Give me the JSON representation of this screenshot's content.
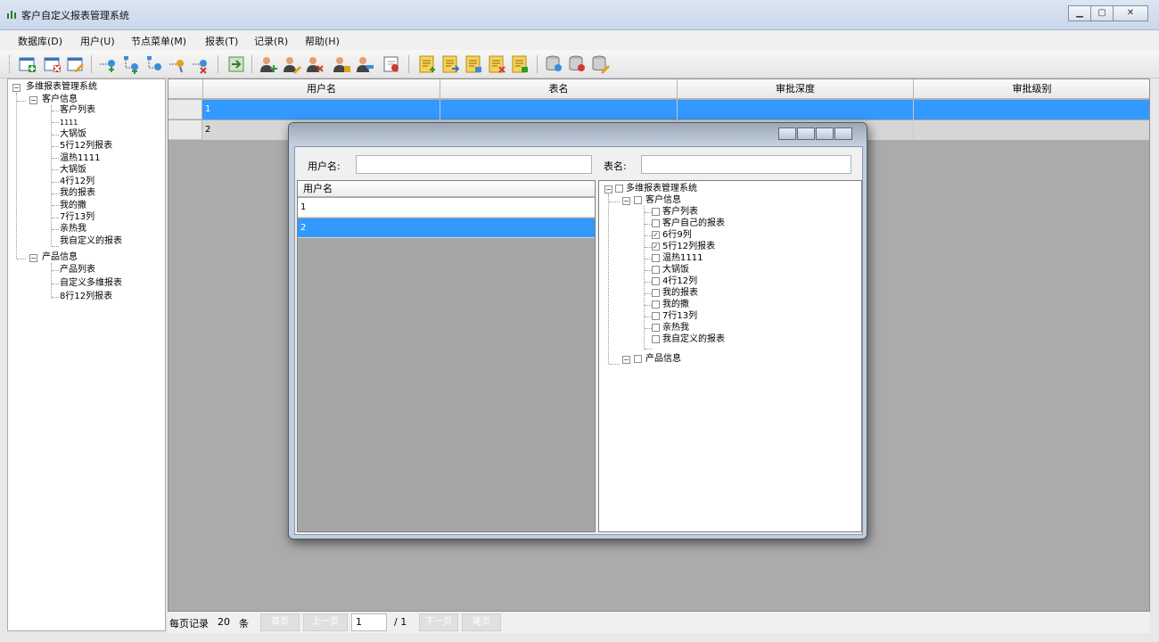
{
  "window": {
    "title": "客户自定义报表管理系统",
    "buttons": [
      "minimize",
      "maximize",
      "close"
    ]
  },
  "menu": [
    {
      "label": "数据库(D)"
    },
    {
      "label": "用户(U)"
    },
    {
      "label": "节点菜单(M)"
    },
    {
      "label": "报表(T)"
    },
    {
      "label": "记录(R)"
    },
    {
      "label": "帮助(H)"
    }
  ],
  "toolbar": {
    "icons": [
      "add-record-icon",
      "delete-record-icon",
      "edit-record-icon",
      "add-node-icon",
      "add-child-node-icon",
      "move-node-icon",
      "edit-node-icon",
      "delete-node-icon",
      "import-icon",
      "add-user-icon",
      "edit-user-icon",
      "delete-user-icon",
      "user-permission-icon",
      "user-group-icon",
      "export-pdf-icon",
      "report-new-icon",
      "report-open-icon",
      "report-edit-icon",
      "report-delete-icon",
      "report-export-icon",
      "database-connect-icon",
      "database-delete-icon",
      "database-edit-icon"
    ]
  },
  "tree": {
    "root": "多维报表管理系统",
    "groups": [
      {
        "label": "客户信息",
        "children": [
          "客户列表",
          "1111",
          "大锅饭",
          "5行12列报表",
          "温热1111",
          "大锅饭",
          "4行12列",
          "我的报表",
          "我的撒",
          "7行13列",
          "亲热我",
          "我自定义的报表"
        ]
      },
      {
        "label": "产品信息",
        "children": [
          "产品列表",
          "自定义多维报表",
          "8行12列报表"
        ]
      }
    ]
  },
  "grid": {
    "columns": [
      "用户名",
      "表名",
      "审批深度",
      "审批级别"
    ],
    "rows": [
      {
        "cells": [
          "1",
          "",
          "",
          ""
        ],
        "selected": true
      },
      {
        "cells": [
          "2",
          "",
          "",
          ""
        ],
        "selected": false
      }
    ]
  },
  "pager": {
    "per_page_prefix": "每页记录",
    "per_page": "20",
    "per_page_suffix": "条",
    "first": "首页",
    "prev": "上一页",
    "page": "1",
    "total": "/ 1",
    "next": "下一页",
    "last": "尾页"
  },
  "dialog": {
    "user_label": "用户名:",
    "user_value": "",
    "table_label": "表名:",
    "table_value": "",
    "list_header": "用户名",
    "users": [
      {
        "name": "1",
        "selected": false
      },
      {
        "name": "2",
        "selected": true
      }
    ],
    "tree": {
      "root": "多维报表管理系统",
      "groups": [
        {
          "label": "客户信息",
          "expanded": true,
          "children": [
            {
              "label": "客户列表",
              "checked": false
            },
            {
              "label": "客户自己的报表",
              "checked": false
            },
            {
              "label": "6行9列",
              "checked": true
            },
            {
              "label": "5行12列报表",
              "checked": true
            },
            {
              "label": "温热1111",
              "checked": false
            },
            {
              "label": "大锅饭",
              "checked": false
            },
            {
              "label": "4行12列",
              "checked": false
            },
            {
              "label": "我的报表",
              "checked": false
            },
            {
              "label": "我的撒",
              "checked": false
            },
            {
              "label": "7行13列",
              "checked": false
            },
            {
              "label": "亲热我",
              "checked": false
            },
            {
              "label": "我自定义的报表",
              "checked": false
            }
          ]
        },
        {
          "label": "产品信息",
          "expanded": false,
          "children": []
        }
      ]
    }
  },
  "colors": {
    "selection": "#3399ff",
    "grid_background": "#ababab"
  }
}
